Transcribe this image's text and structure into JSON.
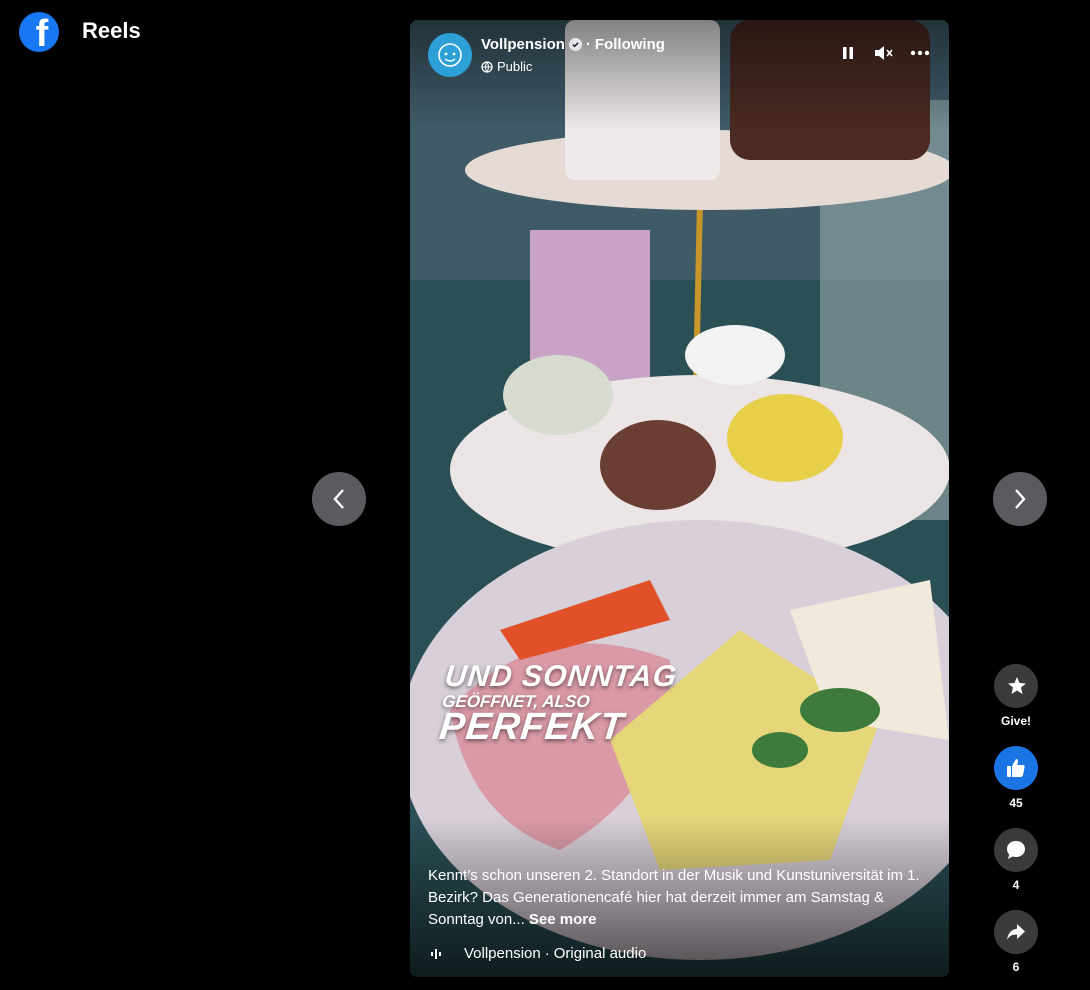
{
  "header": {
    "title": "Reels",
    "logo_letter": "f"
  },
  "reel": {
    "author": "Vollpension",
    "separator": "·",
    "follow_status": "Following",
    "privacy": "Public",
    "controls": [
      "pause-icon",
      "mute-icon",
      "more-icon"
    ],
    "overlay_text": {
      "line1": "UND SONNTAG",
      "line2": "GEÖFFNET, ALSO",
      "line3": "PERFEKT"
    },
    "caption": "Kennt’s schon unseren 2. Standort in der Musik und Kunstuniversität im 1. Bezirk? Das Generationencafé hier hat derzeit immer am Samstag & Sonntag von...",
    "see_more": "See more",
    "audio": {
      "artist": "Vollpension",
      "separator": "·",
      "label": "Original audio"
    }
  },
  "actions": {
    "give": {
      "label": "Give!"
    },
    "like": {
      "count": "45"
    },
    "comment": {
      "count": "4"
    },
    "share": {
      "count": "6"
    }
  },
  "colors": {
    "facebook_blue": "#1877f2",
    "like_blue": "#1b74e4",
    "button_gray": "#5a5b5e"
  }
}
